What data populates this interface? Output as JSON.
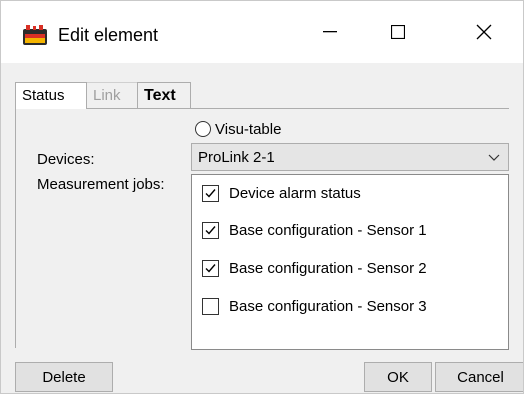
{
  "window": {
    "title": "Edit element"
  },
  "tabs": [
    {
      "label": "Status"
    },
    {
      "label": "Link"
    },
    {
      "label": "Text"
    }
  ],
  "form": {
    "visu_table_label": "Visu-table",
    "devices_label": "Devices:",
    "devices_value": "ProLink 2-1",
    "jobs_label": "Measurement jobs:",
    "jobs": [
      {
        "label": "Device alarm status",
        "checked": true
      },
      {
        "label": "Base configuration - Sensor 1",
        "checked": true
      },
      {
        "label": "Base configuration - Sensor 2",
        "checked": true
      },
      {
        "label": "Base configuration - Sensor 3",
        "checked": false
      }
    ]
  },
  "buttons": {
    "delete": "Delete",
    "ok": "OK",
    "cancel": "Cancel"
  }
}
